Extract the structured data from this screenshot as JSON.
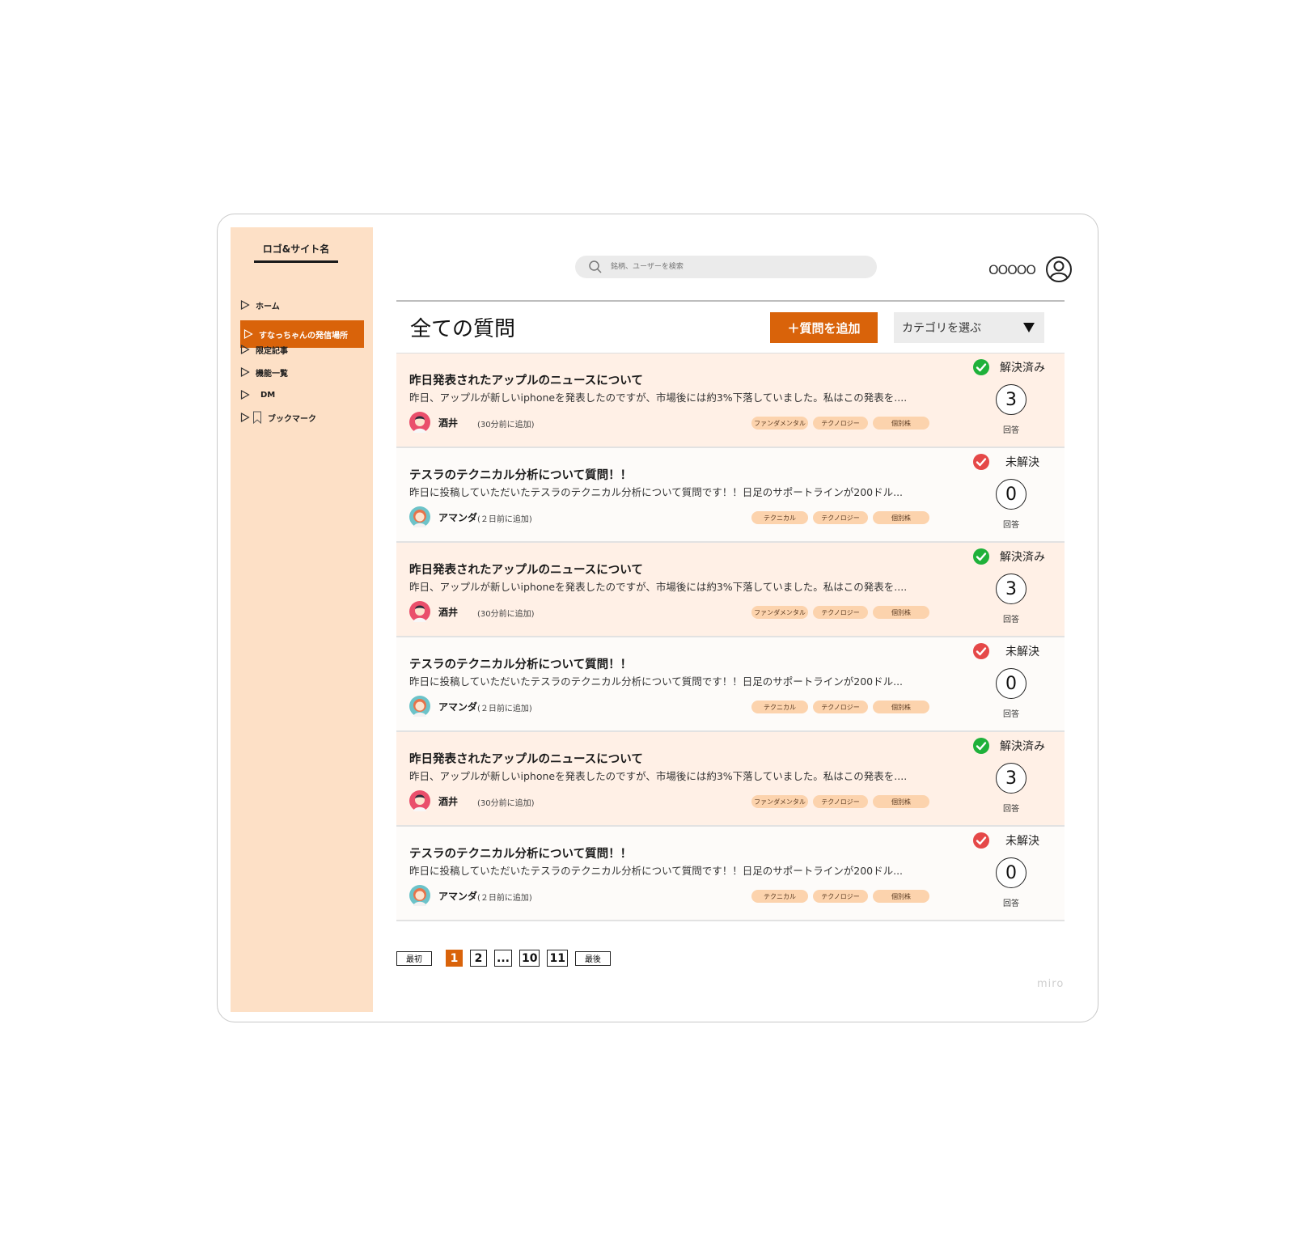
{
  "sidebar": {
    "logo": "ロゴ&サイト名",
    "items": [
      {
        "label": "ホーム",
        "icon": "triangle-outline-icon"
      },
      {
        "label": "すなっちゃんの発信場所",
        "icon": "triangle-outline-icon",
        "active": true
      },
      {
        "label": "限定記事",
        "icon": "triangle-outline-icon"
      },
      {
        "label": "機能一覧",
        "icon": "triangle-outline-icon"
      },
      {
        "label": "DM",
        "icon": "triangle-outline-icon"
      },
      {
        "label": "ブックマーク",
        "icon": "bookmark-icon"
      }
    ]
  },
  "header": {
    "search_placeholder": "銘柄、ユーザーを検索",
    "user_name": "OOOOO"
  },
  "main": {
    "title": "全ての質問",
    "add_button": "＋質問を追加",
    "category_select": "カテゴリを選ぶ",
    "count_label": "回答",
    "questions": [
      {
        "title": "昨日発表されたアップルのニュースについて",
        "body": "昨日、アップルが新しいiphoneを発表したのですが、市場後には約3%下落していました。私はこの発表を....",
        "author": "酒井",
        "time": "(30分前に追加)",
        "tags": [
          "ファンダメンタル",
          "テクノロジー",
          "個別株"
        ],
        "status": "解決済み",
        "solved": true,
        "answers": "3"
      },
      {
        "title": "テスラのテクニカル分析について質問！！",
        "body": "昨日に投稿していただいたテスラのテクニカル分析について質問です！！日足のサポートラインが200ドル...",
        "author": "アマンダ",
        "time": "(２日前に追加)",
        "tags": [
          "テクニカル",
          "テクノロジー",
          "個別株"
        ],
        "status": "未解決",
        "solved": false,
        "answers": "0"
      },
      {
        "title": "昨日発表されたアップルのニュースについて",
        "body": "昨日、アップルが新しいiphoneを発表したのですが、市場後には約3%下落していました。私はこの発表を....",
        "author": "酒井",
        "time": "(30分前に追加)",
        "tags": [
          "ファンダメンタル",
          "テクノロジー",
          "個別株"
        ],
        "status": "解決済み",
        "solved": true,
        "answers": "3"
      },
      {
        "title": "テスラのテクニカル分析について質問！！",
        "body": "昨日に投稿していただいたテスラのテクニカル分析について質問です！！日足のサポートラインが200ドル...",
        "author": "アマンダ",
        "time": "(２日前に追加)",
        "tags": [
          "テクニカル",
          "テクノロジー",
          "個別株"
        ],
        "status": "未解決",
        "solved": false,
        "answers": "0"
      },
      {
        "title": "昨日発表されたアップルのニュースについて",
        "body": "昨日、アップルが新しいiphoneを発表したのですが、市場後には約3%下落していました。私はこの発表を....",
        "author": "酒井",
        "time": "(30分前に追加)",
        "tags": [
          "ファンダメンタル",
          "テクノロジー",
          "個別株"
        ],
        "status": "解決済み",
        "solved": true,
        "answers": "3"
      },
      {
        "title": "テスラのテクニカル分析について質問！！",
        "body": "昨日に投稿していただいたテスラのテクニカル分析について質問です！！日足のサポートラインが200ドル...",
        "author": "アマンダ",
        "time": "(２日前に追加)",
        "tags": [
          "テクニカル",
          "テクノロジー",
          "個別株"
        ],
        "status": "未解決",
        "solved": false,
        "answers": "0"
      }
    ]
  },
  "pagination": {
    "first": "最初",
    "pages": [
      "1",
      "2",
      "...",
      "10",
      "11"
    ],
    "current": "1",
    "last": "最後"
  },
  "watermark": "miro",
  "colors": {
    "accent": "#d9630a",
    "sidebar_bg": "#fde0c6",
    "tag_bg": "#fcd3ad",
    "solved": "#1fb13a",
    "unsolved": "#e54848"
  }
}
